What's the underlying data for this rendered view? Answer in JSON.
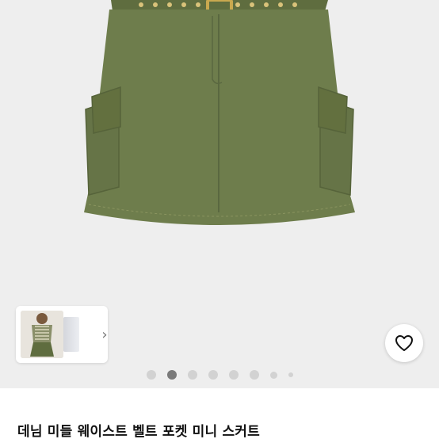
{
  "product": {
    "title": "데님 미들 웨이스트 벨트 포켓 미니 스커트",
    "image_icon": "skirt-product-image"
  },
  "gallery": {
    "thumbnail_icon": "model-thumbnail",
    "next_icon": "chevron-right-icon",
    "next_label": "›",
    "dots_total": 8,
    "active_dot": 2
  },
  "wishlist": {
    "icon": "heart-icon"
  },
  "colors": {
    "skirt": "#6e7d4c",
    "background": "#eeeeee",
    "dot_active": "#7a7a7a",
    "dot_inactive": "#d2d2d2"
  }
}
